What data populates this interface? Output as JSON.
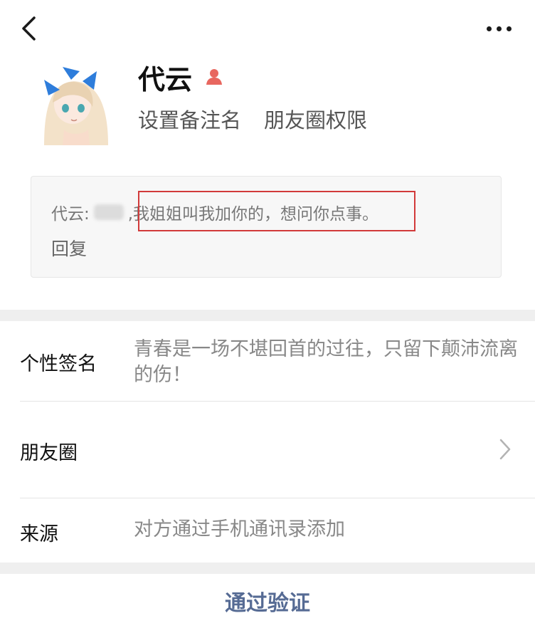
{
  "nav": {
    "back_icon": "chevron-left-icon",
    "more_icon": "more-dots-icon"
  },
  "profile": {
    "nickname": "代云",
    "gender_icon": "gender-female-icon",
    "gender_color": "#e8675f",
    "set_remark_label": "设置备注名",
    "moments_permission_label": "朋友圈权限"
  },
  "verification_message": {
    "sender_prefix": "代云:",
    "text": ",我姐姐叫我加你的，想问你点事。",
    "highlight_color": "#d23a3a",
    "reply_label": "回复"
  },
  "info": {
    "signature_label": "个性签名",
    "signature_value": "青春是一场不堪回首的过往，只留下颠沛流离的伤！",
    "moments_label": "朋友圈",
    "source_label": "来源",
    "source_value": "对方通过手机通讯录添加"
  },
  "actions": {
    "verify_label": "通过验证",
    "verify_color": "#566b94"
  }
}
